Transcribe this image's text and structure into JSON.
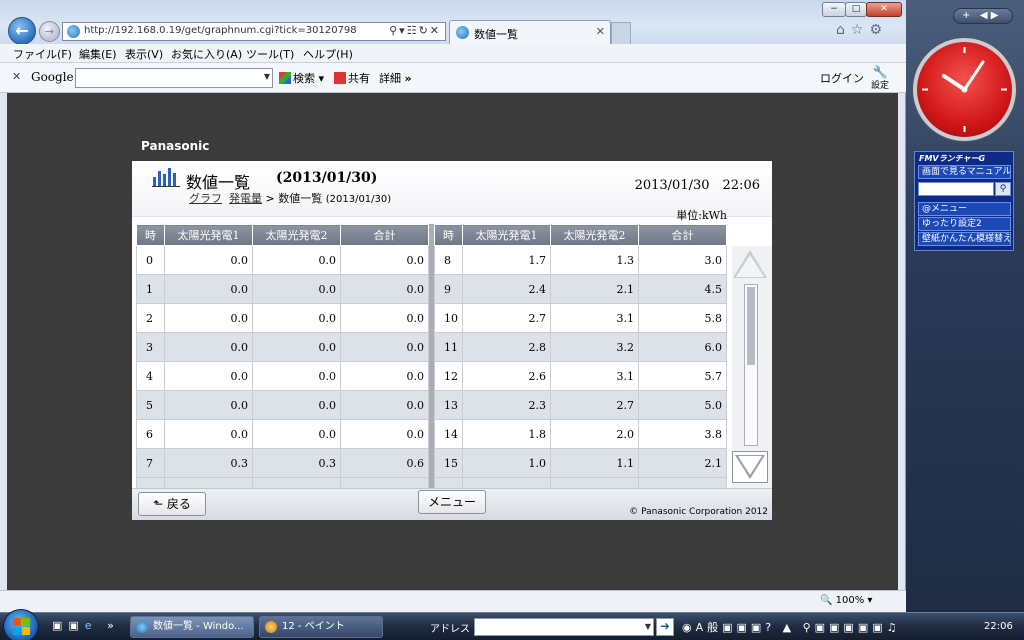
{
  "browser": {
    "url": "http://192.168.0.19/get/graphnum.cgi?tick=30120798",
    "tab_title": "数値一覧",
    "menu": [
      "ファイル(F)",
      "編集(E)",
      "表示(V)",
      "お気に入り(A)",
      "ツール(T)",
      "ヘルプ(H)"
    ],
    "window_controls": {
      "min": "−",
      "max": "□",
      "close": "✕"
    },
    "zoom": "100%"
  },
  "google_bar": {
    "close": "✕",
    "logo": "Google",
    "search_label": "検索",
    "share_label": "共有",
    "detail_label": "詳細",
    "more_label": "»",
    "login_label": "ログイン",
    "settings_label": "設定"
  },
  "page": {
    "brand": "Panasonic",
    "title": "数値一覧",
    "title_date": "(2013/01/30)",
    "breadcrumb": {
      "graph": "グラフ",
      "generation": "発電量",
      "separator": ">",
      "current": "数値一覧",
      "current_date": "(2013/01/30)"
    },
    "datetime": "2013/01/30　22:06",
    "unit": "単位:kWh",
    "columns": [
      "時",
      "太陽光発電1",
      "太陽光発電2",
      "合計"
    ],
    "left_rows": [
      [
        "0",
        "0.0",
        "0.0",
        "0.0"
      ],
      [
        "1",
        "0.0",
        "0.0",
        "0.0"
      ],
      [
        "2",
        "0.0",
        "0.0",
        "0.0"
      ],
      [
        "3",
        "0.0",
        "0.0",
        "0.0"
      ],
      [
        "4",
        "0.0",
        "0.0",
        "0.0"
      ],
      [
        "5",
        "0.0",
        "0.0",
        "0.0"
      ],
      [
        "6",
        "0.0",
        "0.0",
        "0.0"
      ],
      [
        "7",
        "0.3",
        "0.3",
        "0.6"
      ]
    ],
    "right_rows": [
      [
        "8",
        "1.7",
        "1.3",
        "3.0"
      ],
      [
        "9",
        "2.4",
        "2.1",
        "4.5"
      ],
      [
        "10",
        "2.7",
        "3.1",
        "5.8"
      ],
      [
        "11",
        "2.8",
        "3.2",
        "6.0"
      ],
      [
        "12",
        "2.6",
        "3.1",
        "5.7"
      ],
      [
        "13",
        "2.3",
        "2.7",
        "5.0"
      ],
      [
        "14",
        "1.8",
        "2.0",
        "3.8"
      ],
      [
        "15",
        "1.0",
        "1.1",
        "2.1"
      ]
    ],
    "back_button": "戻る",
    "menu_button": "メニュー",
    "copyright": "© Panasonic Corporation 2012"
  },
  "gadgets": {
    "fmv_title": "FMVランチャーG",
    "fmv_items": [
      "画面で見るマニュアル",
      "@メニュー",
      "ゆったり設定2",
      "壁紙かんたん模様替え"
    ]
  },
  "taskbar": {
    "tasks": [
      "数値一覧 - Windo...",
      "12 - ペイント"
    ],
    "address_label": "アドレス",
    "clock": "22:06"
  }
}
